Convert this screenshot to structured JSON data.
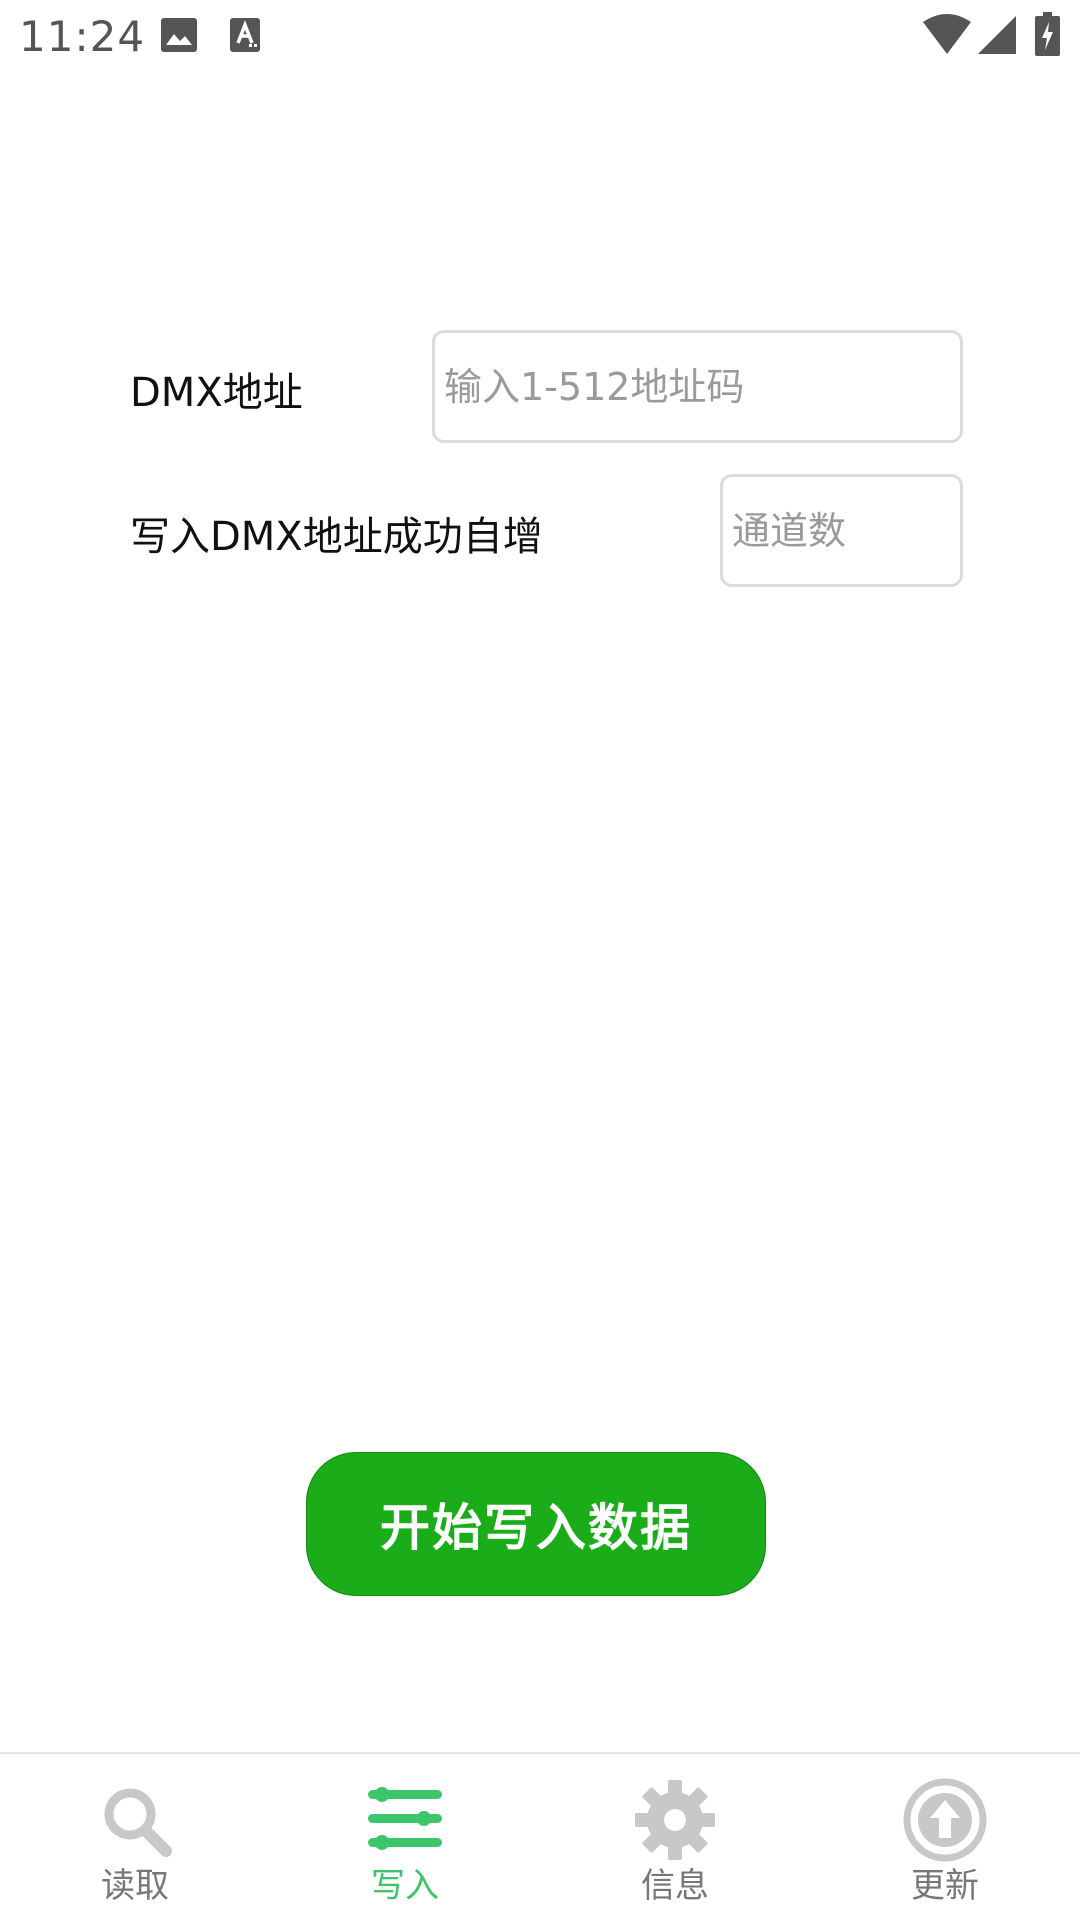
{
  "status_bar": {
    "time": "11:24",
    "icons": [
      "image-icon",
      "text-a-icon",
      "wifi-icon",
      "cell-signal-icon",
      "battery-charging-icon"
    ]
  },
  "form": {
    "dmx_address_label": "DMX地址",
    "dmx_address_placeholder": "输入1-512地址码",
    "dmx_address_value": "",
    "auto_increment_label": "写入DMX地址成功自增",
    "channels_placeholder": "通道数",
    "channels_value": ""
  },
  "actions": {
    "start_write_label": "开始写入数据",
    "start_write_color": "#1aad19"
  },
  "tab_bar": {
    "active_index": 1,
    "active_color": "#3cc66a",
    "inactive_color": "#777777",
    "tabs": [
      {
        "label": "读取",
        "icon": "search-icon"
      },
      {
        "label": "写入",
        "icon": "sliders-icon"
      },
      {
        "label": "信息",
        "icon": "gear-icon"
      },
      {
        "label": "更新",
        "icon": "upload-arrow-icon"
      }
    ]
  }
}
